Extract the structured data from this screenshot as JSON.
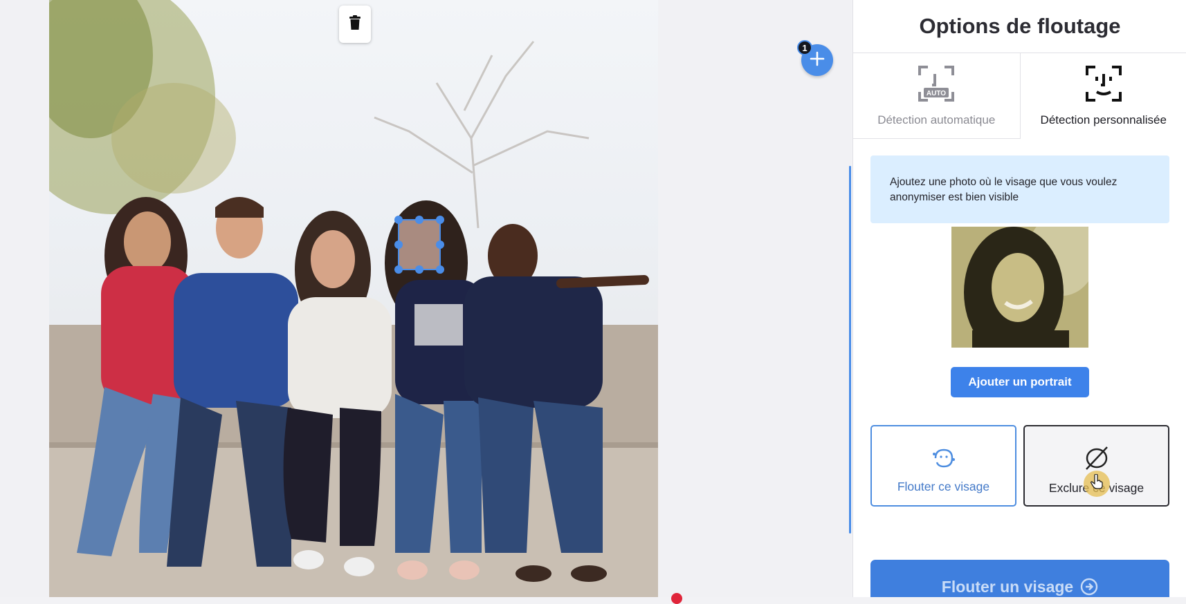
{
  "canvas": {
    "delete_icon": "trash-icon",
    "add_icon": "plus-icon",
    "add_badge": "1"
  },
  "panel": {
    "title": "Options de floutage",
    "tabs": [
      {
        "label": "Détection automatique",
        "icon": "face-scan-auto-icon",
        "active": false,
        "badge": "AUTO"
      },
      {
        "label": "Détection personnalisée",
        "icon": "face-scan-icon",
        "active": true
      }
    ],
    "info_text": "Ajoutez une photo où le visage que vous voulez anonymiser est bien visible",
    "add_portrait_label": "Ajouter un portrait",
    "choices": [
      {
        "label": "Flouter ce visage",
        "icon": "blur-face-icon"
      },
      {
        "label": "Exclure ce visage",
        "icon": "exclude-face-icon"
      }
    ],
    "cta_label": "Flouter un visage",
    "cta_icon": "arrow-circle-icon"
  },
  "colors": {
    "accent": "#3d82ea",
    "info_bg": "#dbeeff",
    "check": "#2fb872"
  }
}
